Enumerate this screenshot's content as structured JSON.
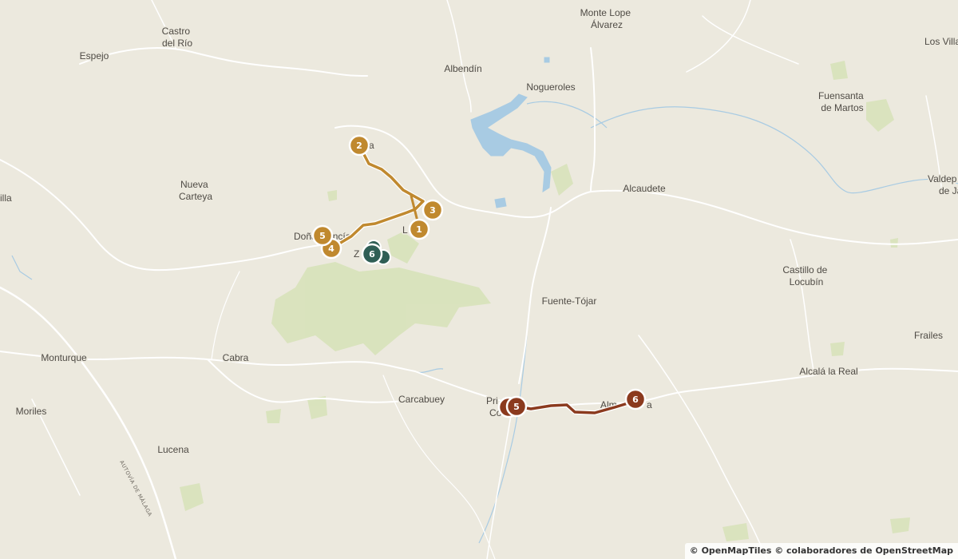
{
  "map": {
    "colors": {
      "background": "#ece9de",
      "water": "#a8cbe3",
      "park": "#d7e2b9",
      "road": "#ffffff",
      "route_gold": "#c0892f",
      "route_teal": "#2f5e55",
      "route_brown": "#8b3a1e"
    },
    "places": [
      {
        "id": "castro-del-rio",
        "lines": [
          "Castro",
          "del Río"
        ]
      },
      {
        "id": "espejo",
        "lines": [
          "Espejo"
        ]
      },
      {
        "id": "monte-lope-alvarez",
        "lines": [
          "Monte Lope",
          "Álvarez"
        ]
      },
      {
        "id": "los-villares",
        "lines": [
          "Los Villa"
        ]
      },
      {
        "id": "albendin",
        "lines": [
          "Albendín"
        ]
      },
      {
        "id": "nogueroles",
        "lines": [
          "Nogueroles"
        ]
      },
      {
        "id": "fuensanta-de-martos",
        "lines": [
          "Fuensanta",
          "de Martos"
        ]
      },
      {
        "id": "baena",
        "lines": [
          "a"
        ]
      },
      {
        "id": "nueva-carteya",
        "lines": [
          "Nueva",
          "Carteya"
        ]
      },
      {
        "id": "valdepenas",
        "lines": [
          "Valdep",
          "de Ja"
        ]
      },
      {
        "id": "alcaudete",
        "lines": [
          "Alcaudete"
        ]
      },
      {
        "id": "villa",
        "lines": [
          "illa"
        ]
      },
      {
        "id": "dona-mencia",
        "lines": [
          "Doña Mencía"
        ]
      },
      {
        "id": "luque",
        "lines": [
          "L"
        ]
      },
      {
        "id": "zuheros",
        "lines": [
          "Z"
        ]
      },
      {
        "id": "castillo-de-locubin",
        "lines": [
          "Castillo de",
          "Locubín"
        ]
      },
      {
        "id": "fuente-tojar",
        "lines": [
          "Fuente-Tójar"
        ]
      },
      {
        "id": "frailes",
        "lines": [
          "Frailes"
        ]
      },
      {
        "id": "monturque",
        "lines": [
          "Monturque"
        ]
      },
      {
        "id": "cabra",
        "lines": [
          "Cabra"
        ]
      },
      {
        "id": "alcala-la-real",
        "lines": [
          "Alcalá la Real"
        ]
      },
      {
        "id": "carcabuey",
        "lines": [
          "Carcabuey"
        ]
      },
      {
        "id": "priego",
        "lines": [
          "Pri",
          "Có"
        ]
      },
      {
        "id": "almedinilla",
        "lines": [
          "Alm",
          "a"
        ]
      },
      {
        "id": "moriles",
        "lines": [
          "Moriles"
        ]
      },
      {
        "id": "lucena",
        "lines": [
          "Lucena"
        ]
      }
    ],
    "road_label": "AUTOVÍA DE MÁLAGA",
    "routes": [
      {
        "id": "route-gold",
        "color": "#c0892f",
        "stops": [
          {
            "n": "1",
            "label": "1"
          },
          {
            "n": "2",
            "label": "2"
          },
          {
            "n": "3",
            "label": "3"
          },
          {
            "n": "4",
            "label": "4"
          },
          {
            "n": "5",
            "label": "5"
          }
        ]
      },
      {
        "id": "route-teal",
        "color": "#2f5e55",
        "stops": [
          {
            "n": "6",
            "label": "6"
          }
        ]
      },
      {
        "id": "route-brown",
        "color": "#8b3a1e",
        "stops": [
          {
            "n": "5",
            "label": "5"
          },
          {
            "n": "6",
            "label": "6"
          }
        ]
      }
    ],
    "attribution": "© OpenMapTiles © colaboradores de OpenStreetMap"
  }
}
